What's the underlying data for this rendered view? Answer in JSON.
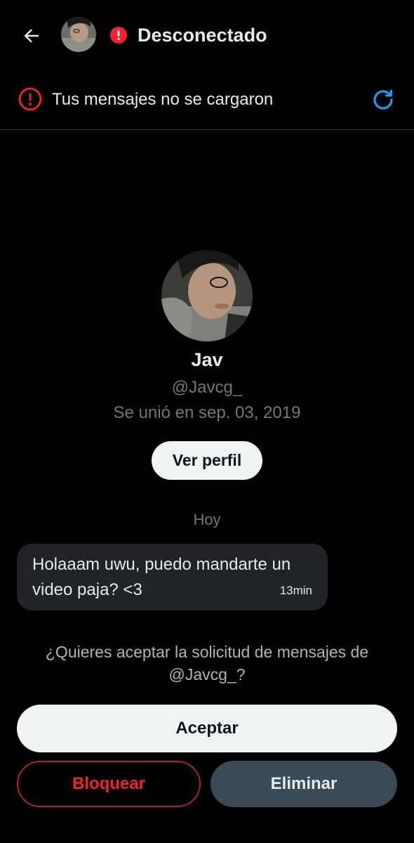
{
  "header": {
    "back_icon": "arrow-left-icon",
    "status_icon": "alert-circle-icon",
    "title": "Desconectado"
  },
  "banner": {
    "icon": "alert-circle-icon",
    "text": "Tus mensajes no se cargaron",
    "refresh_icon": "refresh-icon"
  },
  "profile": {
    "name": "Jav",
    "handle": "@Javcg_",
    "joined": "Se unió en sep. 03, 2019",
    "view_profile_label": "Ver perfil"
  },
  "conversation": {
    "day_label": "Hoy",
    "messages": [
      {
        "text": "Holaaam uwu, puedo mandarte un video paja? <3",
        "time": "13min"
      }
    ]
  },
  "request": {
    "question": "¿Quieres aceptar la solicitud de mensajes de @Javcg_?",
    "accept_label": "Aceptar",
    "block_label": "Bloquear",
    "delete_label": "Eliminar"
  },
  "colors": {
    "background": "#000000",
    "error_red": "#f4212e",
    "refresh_blue": "#1d9bf0",
    "secondary_text": "#71767b"
  }
}
